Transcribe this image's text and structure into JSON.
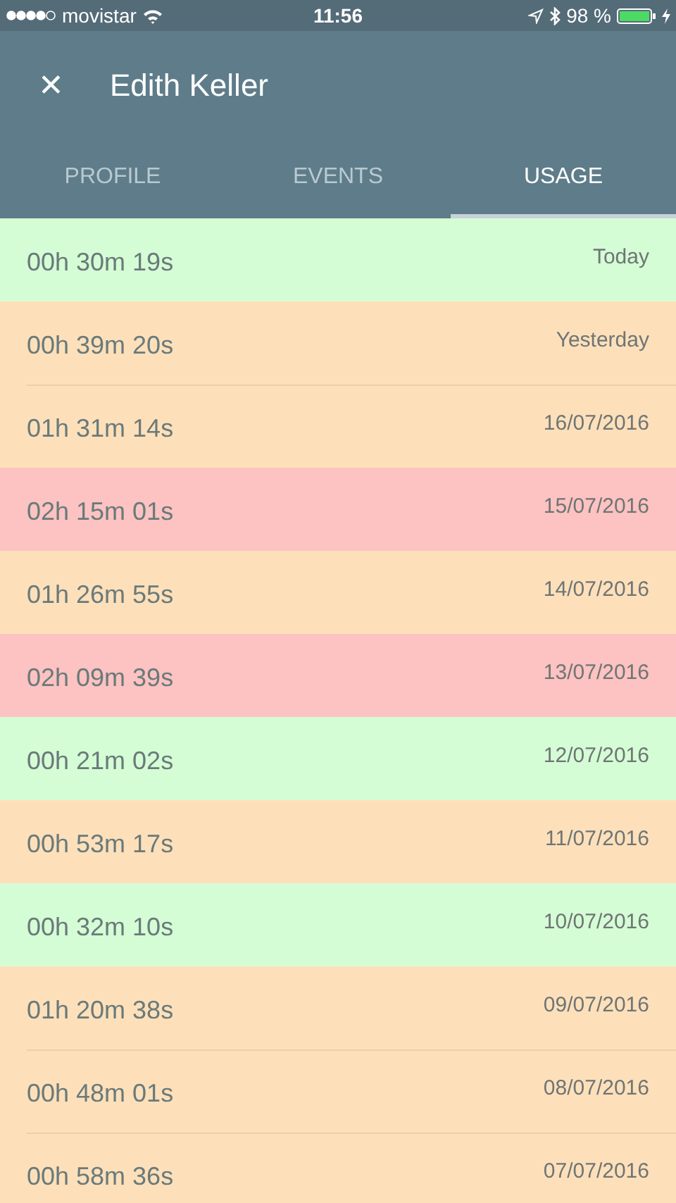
{
  "status_bar": {
    "carrier": "movistar",
    "time": "11:56",
    "battery_text": "98 %"
  },
  "header": {
    "close_icon": "✕",
    "title": "Edith Keller"
  },
  "tabs": [
    {
      "label": "PROFILE",
      "selected": false
    },
    {
      "label": "EVENTS",
      "selected": false
    },
    {
      "label": "USAGE",
      "selected": true
    }
  ],
  "usage_rows": [
    {
      "duration": "00h 30m 19s",
      "date": "Today",
      "color": "#d5fdd5"
    },
    {
      "duration": "00h 39m 20s",
      "date": "Yesterday",
      "color": "#fde0ba"
    },
    {
      "duration": "01h 31m 14s",
      "date": "16/07/2016",
      "color": "#fde0ba"
    },
    {
      "duration": "02h 15m 01s",
      "date": "15/07/2016",
      "color": "#fdc2c2"
    },
    {
      "duration": "01h 26m 55s",
      "date": "14/07/2016",
      "color": "#fde0ba"
    },
    {
      "duration": "02h 09m 39s",
      "date": "13/07/2016",
      "color": "#fdc2c2"
    },
    {
      "duration": "00h 21m 02s",
      "date": "12/07/2016",
      "color": "#d5fdd5"
    },
    {
      "duration": "00h 53m 17s",
      "date": "11/07/2016",
      "color": "#fde0ba"
    },
    {
      "duration": "00h 32m 10s",
      "date": "10/07/2016",
      "color": "#d5fdd5"
    },
    {
      "duration": "01h 20m 38s",
      "date": "09/07/2016",
      "color": "#fde0ba"
    },
    {
      "duration": "00h 48m 01s",
      "date": "08/07/2016",
      "color": "#fde0ba"
    },
    {
      "duration": "00h 58m 36s",
      "date": "07/07/2016",
      "color": "#fde0ba"
    }
  ]
}
